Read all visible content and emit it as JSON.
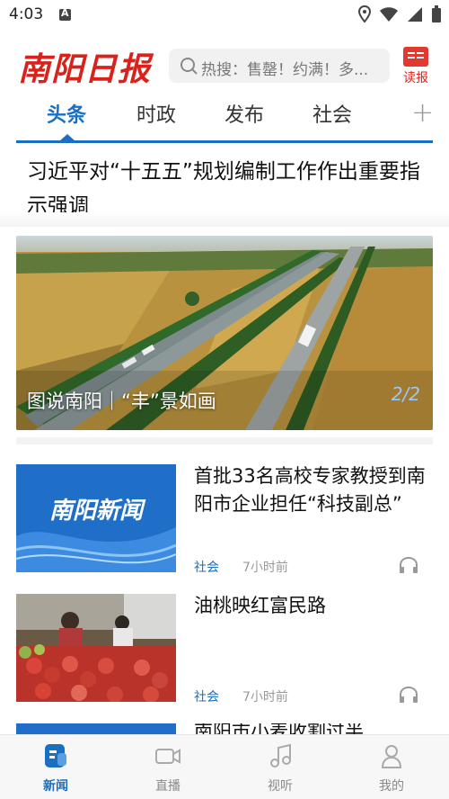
{
  "status_bar": {
    "time": "4:03"
  },
  "header": {
    "logo": "南阳日报",
    "search_placeholder": "热搜：售罄！约满！多...",
    "reader_label": "读报"
  },
  "tabs": [
    {
      "label": "头条",
      "active": true
    },
    {
      "label": "时政",
      "active": false
    },
    {
      "label": "发布",
      "active": false
    },
    {
      "label": "社会",
      "active": false
    }
  ],
  "headline": "习近平对“十五五”规划编制工作作出重要指示强调",
  "banner": {
    "caption": "图说南阳｜“丰”景如画",
    "page": "2/2"
  },
  "news": [
    {
      "title": "首批33名高校专家教授到南阳市企业担任“科技副总”",
      "tag": "社会",
      "time": "7小时前",
      "thumb_text": "南阳新闻"
    },
    {
      "title": "油桃映红富民路",
      "tag": "社会",
      "time": "7小时前"
    },
    {
      "title": "南阳市小麦收割过半"
    }
  ],
  "bottom_nav": [
    {
      "label": "新闻",
      "icon": "news-icon",
      "active": true
    },
    {
      "label": "直播",
      "icon": "video-camera-icon",
      "active": false
    },
    {
      "label": "视听",
      "icon": "music-note-icon",
      "active": false
    },
    {
      "label": "我的",
      "icon": "user-icon",
      "active": false
    }
  ],
  "colors": {
    "brand_red": "#d8231c",
    "accent_blue": "#1a6fc0"
  }
}
